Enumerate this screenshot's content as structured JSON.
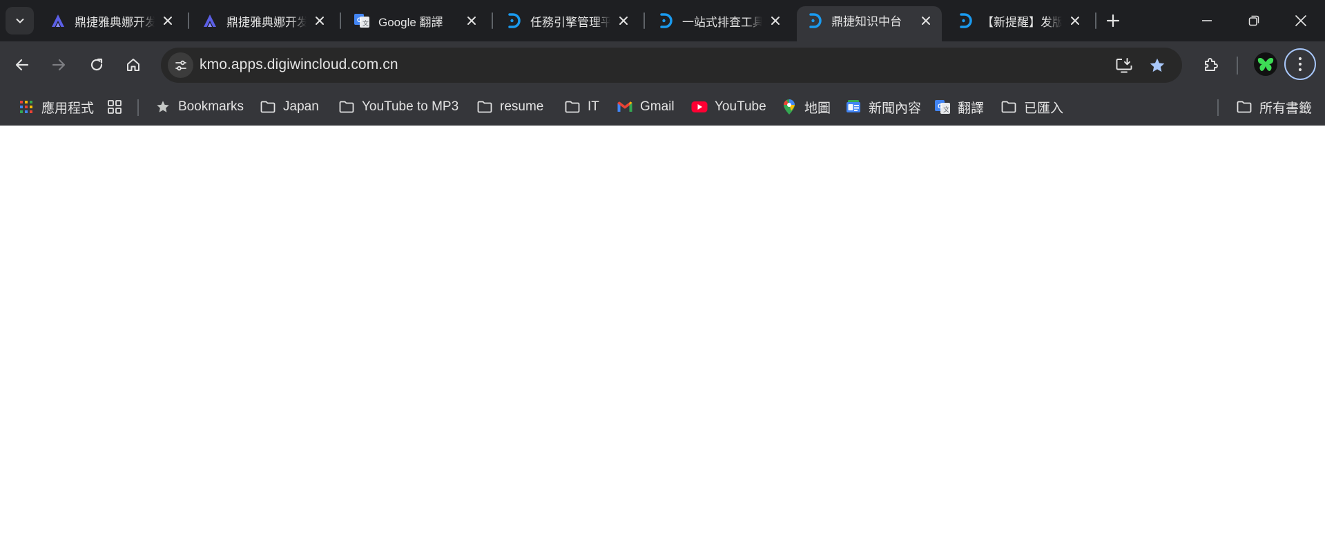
{
  "tabs": [
    {
      "title": "鼎捷雅典娜开发平台",
      "icon": "athena-logo-icon",
      "active": false
    },
    {
      "title": "鼎捷雅典娜开发平台",
      "icon": "athena-logo-icon",
      "active": false
    },
    {
      "title": "Google 翻譯",
      "icon": "google-translate-icon",
      "active": false
    },
    {
      "title": "任務引擎管理平台",
      "icon": "digiwin-logo-icon",
      "active": false
    },
    {
      "title": "一站式排查工具",
      "icon": "digiwin-logo-icon",
      "active": false
    },
    {
      "title": "鼎捷知识中台",
      "icon": "digiwin-logo-icon",
      "active": true
    },
    {
      "title": "【新提醒】发版",
      "icon": "digiwin-logo-icon",
      "active": false
    }
  ],
  "address_bar": {
    "url": "kmo.apps.digiwincloud.com.cn"
  },
  "bookmarks": [
    {
      "label": "應用程式",
      "icon": "apps-grid-icon"
    },
    {
      "label": "",
      "icon": "tab-groups-icon"
    },
    {
      "label": "Bookmarks",
      "icon": "star-icon"
    },
    {
      "label": "Japan",
      "icon": "folder-icon"
    },
    {
      "label": "YouTube to MP3",
      "icon": "folder-icon"
    },
    {
      "label": "resume",
      "icon": "folder-icon"
    },
    {
      "label": "IT",
      "icon": "folder-icon"
    },
    {
      "label": "Gmail",
      "icon": "gmail-icon"
    },
    {
      "label": "YouTube",
      "icon": "youtube-icon"
    },
    {
      "label": "地圖",
      "icon": "google-maps-icon"
    },
    {
      "label": "新聞內容",
      "icon": "google-news-icon"
    },
    {
      "label": "翻譯",
      "icon": "google-translate-icon"
    },
    {
      "label": "已匯入",
      "icon": "folder-icon"
    }
  ],
  "all_bookmarks": {
    "label": "所有書籤",
    "icon": "folder-icon"
  },
  "colors": {
    "frame": "#1e1f22",
    "toolbar": "#35363a",
    "omnibox": "#282828",
    "text": "#e3e3e3",
    "accent_star": "#a8c7fa",
    "digiwin_blue": "#1a9bf0"
  }
}
